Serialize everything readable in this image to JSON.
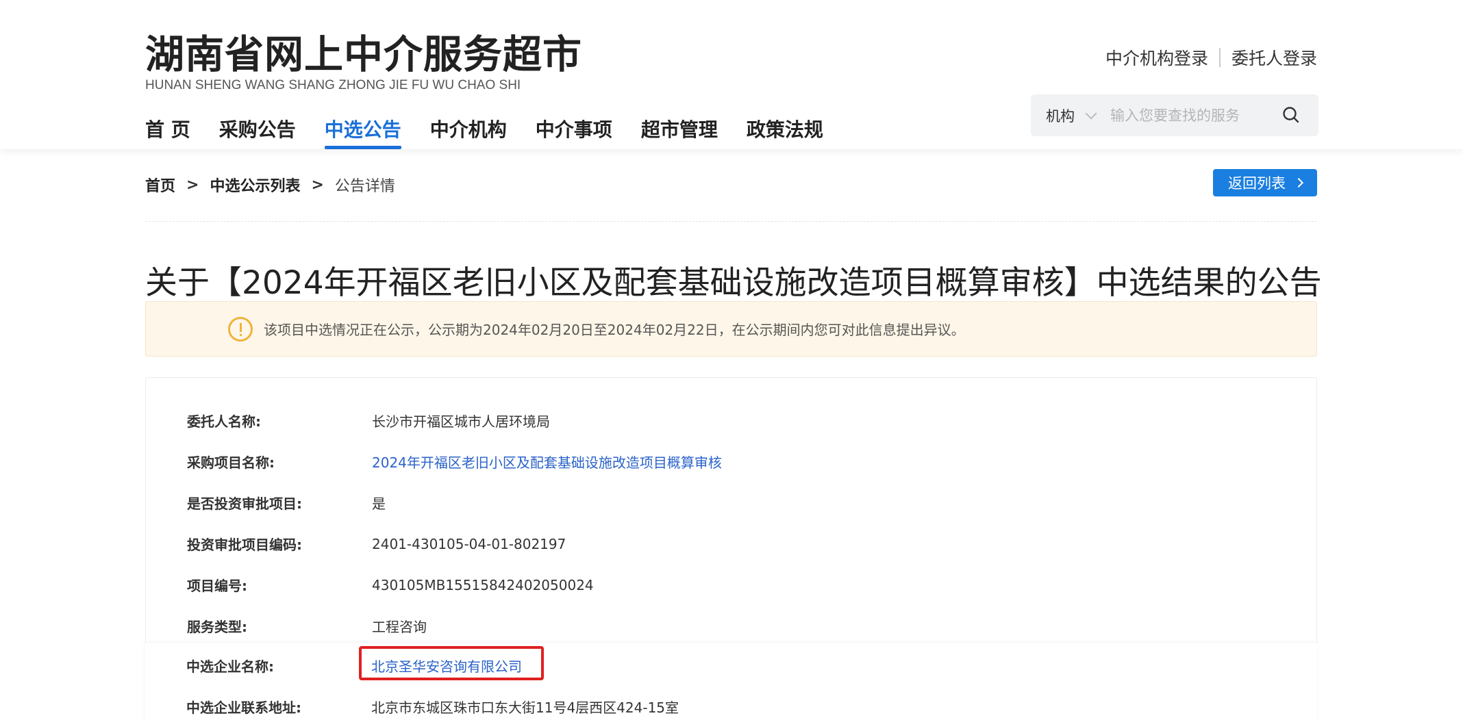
{
  "header": {
    "title": "湖南省网上中介服务超市",
    "subtitle": "HUNAN SHENG WANG SHANG ZHONG JIE FU WU CHAO SHI",
    "login_agency": "中介机构登录",
    "login_client": "委托人登录"
  },
  "nav": {
    "items": [
      {
        "label": "首 页"
      },
      {
        "label": "采购公告"
      },
      {
        "label": "中选公告",
        "active": true
      },
      {
        "label": "中介机构"
      },
      {
        "label": "中介事项"
      },
      {
        "label": "超市管理"
      },
      {
        "label": "政策法规"
      }
    ]
  },
  "search": {
    "category": "机构",
    "placeholder": "输入您要查找的服务",
    "icon": "search-icon"
  },
  "breadcrumb": {
    "home": "首页",
    "sep": ">",
    "list": "中选公示列表",
    "current": "公告详情"
  },
  "back_button": "返回列表",
  "page_title": "关于【2024年开福区老旧小区及配套基础设施改造项目概算审核】中选结果的公告",
  "notice": {
    "icon": "warning-icon",
    "text": "该项目中选情况正在公示，公示期为2024年02月20日至2024年02月22日，在公示期间内您可对此信息提出异议。"
  },
  "details": [
    {
      "label": "委托人名称:",
      "value": "长沙市开福区城市人居环境局"
    },
    {
      "label": "采购项目名称:",
      "value": "2024年开福区老旧小区及配套基础设施改造项目概算审核"
    },
    {
      "label": "是否投资审批项目:",
      "value": "是"
    },
    {
      "label": "投资审批项目编码:",
      "value": "2401-430105-04-01-802197"
    },
    {
      "label": "项目编号:",
      "value": "430105MB1551584240205002​4"
    },
    {
      "label": "服务类型:",
      "value": "工程咨询"
    },
    {
      "label": "中选企业名称:",
      "value": "北京圣华安咨询有限公司"
    },
    {
      "label": "中选企业联系地址:",
      "value": "北京市东城区珠市口东大街11号4层西区424-15室"
    }
  ],
  "colors": {
    "accent": "#1a6fd8",
    "button": "#1a7fe0",
    "notice_bg": "#fef6e8",
    "warning": "#f2b23a",
    "link": "#2a62c9",
    "highlight": "#e02020"
  }
}
